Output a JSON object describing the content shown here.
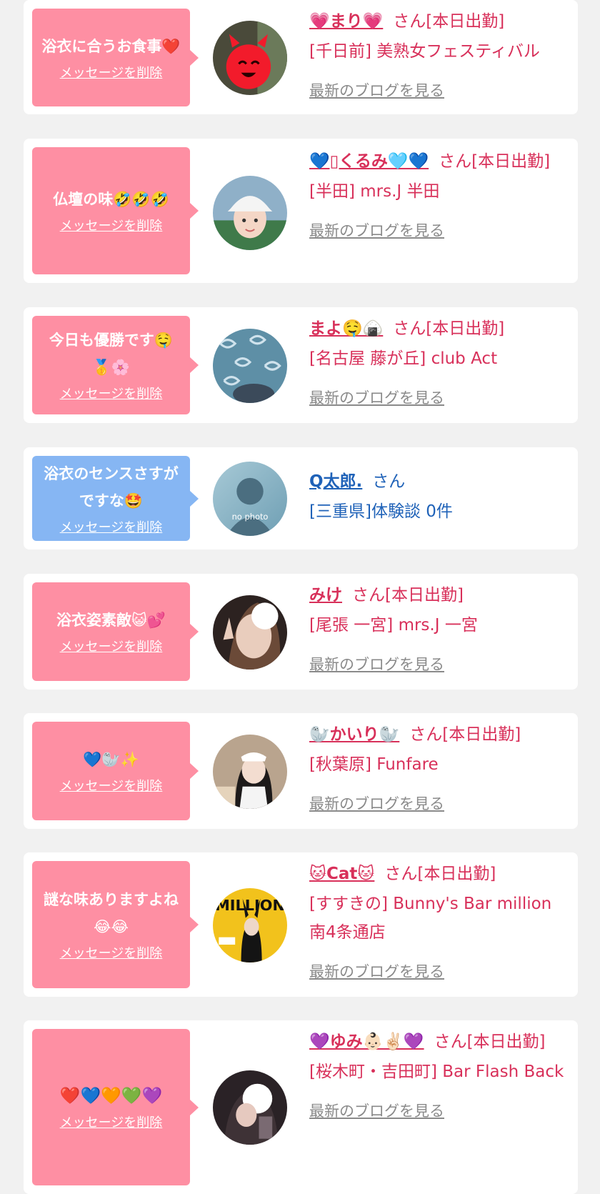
{
  "colors": {
    "background": "#f1f1f1",
    "card": "#ffffff",
    "bubble_pink": "#fe8fa3",
    "bubble_blue": "#86b6f3",
    "text_pink": "#d8305a",
    "text_blue": "#1f62b8",
    "blog_gray": "#8a8a8a"
  },
  "delete_label": "メッセージを削除",
  "blog_label": "最新のブログを見る",
  "messages": [
    {
      "message": "浴衣に合うお食事❤️",
      "name": "💗まり💗",
      "suffix": "さん[本日出勤]",
      "shop": "[千日前] 美熟女フェスティバル",
      "avatar_icon": "red-devil-sticker-photo",
      "type": "cast"
    },
    {
      "message": "仏壇の味🤣🤣🤣",
      "name": "💙▯くるみ🩵💙",
      "suffix": "さん[本日出勤]",
      "shop": "[半田] mrs.J 半田",
      "avatar_icon": "woman-white-cap-photo",
      "type": "cast"
    },
    {
      "message": "今日も優勝です🤤🥇🌸",
      "name": "まよ🤤🍙",
      "suffix": "さん[本日出勤]",
      "shop": "[名古屋 藤が丘] club Act",
      "avatar_icon": "blue-pattern-photo",
      "type": "cast"
    },
    {
      "message": "浴衣のセンスさすがですな🤩",
      "name": "Q太郎.",
      "suffix": "さん",
      "shop": "[三重県]体験談 0件",
      "avatar_icon": "no-photo-silhouette",
      "avatar_label": "no photo",
      "type": "user"
    },
    {
      "message": "浴衣姿素敵😺💕",
      "name": "みけ",
      "suffix": "さん[本日出勤]",
      "shop": "[尾張 一宮] mrs.J 一宮",
      "avatar_icon": "woman-peace-sign-photo",
      "type": "cast"
    },
    {
      "message": "💙🦭✨",
      "name": "🦭かいり🦭",
      "suffix": "さん[本日出勤]",
      "shop": "[秋葉原] Funfare",
      "avatar_icon": "maid-costume-photo",
      "type": "cast"
    },
    {
      "message": "謎な味ありますよね😂😂",
      "name": "🐱Cat🐱",
      "suffix": "さん[本日出勤]",
      "shop": "[すすきの] Bunny's Bar million 南4条通店",
      "avatar_icon": "million-magazine-cover",
      "avatar_label": "MILLION",
      "type": "cast"
    },
    {
      "message": "❤️💙🧡💚💜",
      "name": "💜ゆみ👶🏻✌🏻💜",
      "suffix": "さん[本日出勤]",
      "shop": "[桜木町・吉田町] Bar Flash Back",
      "avatar_icon": "woman-sticker-photo",
      "type": "cast"
    }
  ]
}
